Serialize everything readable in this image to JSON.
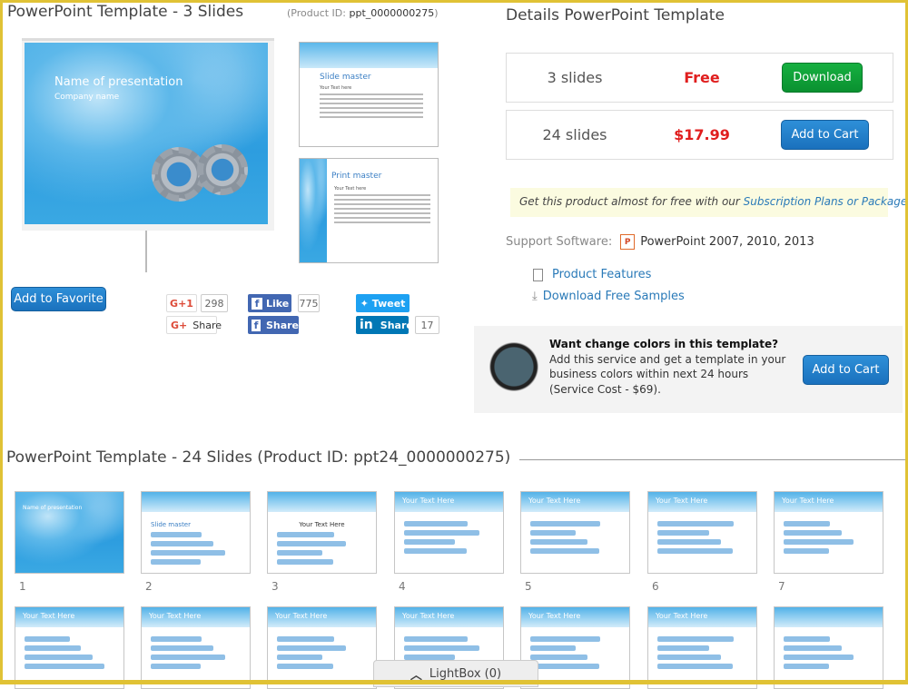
{
  "left": {
    "title": "PowerPoint Template - 3 Slides",
    "product_id_label": "(Product ID:",
    "product_id": "ppt_0000000275",
    "product_id_close": ")",
    "preview": {
      "title": "Name of presentation",
      "subtitle": "Company name"
    },
    "masters": [
      {
        "title": "Slide master",
        "bullet": "Your Text here"
      },
      {
        "title": "Print master",
        "bullet": "Your Text here"
      }
    ],
    "favorite": "Add to Favorite",
    "social": {
      "gplus": "G+1",
      "gplus_count": "298",
      "gshare": "Share",
      "fb_like": "Like",
      "fb_count": "775",
      "fb_share": "Share",
      "tweet": "Tweet",
      "in_share": "Share",
      "in_count": "17"
    }
  },
  "details": {
    "title": "Details PowerPoint Template",
    "rows": [
      {
        "slides": "3 slides",
        "price": "Free",
        "button": "Download"
      },
      {
        "slides": "24 slides",
        "price": "$17.99",
        "button": "Add to Cart"
      }
    ],
    "promo_text": "Get this product almost for free with our ",
    "promo_link": "Subscription Plans or Packages",
    "promo_end": ".",
    "support_label": "Support Software:",
    "support_value": "PowerPoint 2007, 2010, 2013",
    "links": [
      "Product Features",
      "Download Free Samples"
    ],
    "service": {
      "title": "Want change colors in this template?",
      "text": "Add this service and get a template in your business colors within next 24 hours (Service Cost - $69).",
      "button": "Add to Cart"
    }
  },
  "slides24": {
    "title": "PowerPoint Template - 24 Slides (Product ID: ppt24_0000000275)",
    "row1": [
      {
        "n": "1",
        "h": ""
      },
      {
        "n": "2",
        "h": ""
      },
      {
        "n": "3",
        "h": ""
      },
      {
        "n": "4",
        "h": "Your Text Here"
      },
      {
        "n": "5",
        "h": "Your Text Here"
      },
      {
        "n": "6",
        "h": "Your Text Here"
      },
      {
        "n": "7",
        "h": "Your Text Here"
      }
    ],
    "row2": [
      {
        "h": "Your Text Here"
      },
      {
        "h": "Your Text Here"
      },
      {
        "h": "Your Text Here"
      },
      {
        "h": "Your Text Here"
      },
      {
        "h": "Your Text Here"
      },
      {
        "h": "Your Text Here"
      },
      {
        "h": ""
      }
    ],
    "slide1_title": "Name of presentation",
    "slide2_title": "Slide master",
    "slide3_title": "Your Text Here"
  },
  "lightbox": "LightBox (0)",
  "colors": {
    "accent": "#1a71bd",
    "price": "#e01e1e",
    "download": "#0a9130",
    "frame": "#e0c235"
  }
}
